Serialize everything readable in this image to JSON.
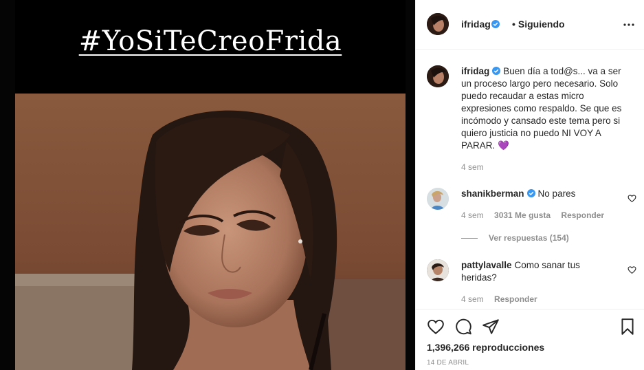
{
  "media": {
    "hashtag": "#YoSiTeCreoFrida"
  },
  "post": {
    "author": "ifridag",
    "follow_status": "Siguiendo",
    "caption": "Buen día a tod@s... va a ser un proceso largo pero necesario. Solo puedo recaudar a estas micro expresiones como respaldo. Se que es incómodo y cansado este tema pero si quiero justicia no puedo NI VOY A PARAR. 💜",
    "caption_time": "4 sem",
    "views": "1,396,266 reproducciones",
    "date": "14 DE ABRIL"
  },
  "comments": [
    {
      "username": "shanikberman",
      "text": "No pares",
      "time": "4 sem",
      "likes": "3031 Me gusta",
      "reply": "Responder",
      "view_replies": "Ver respuestas (154)"
    },
    {
      "username": "pattylavalle",
      "text": "Como sanar tus heridas?",
      "time": "4 sem",
      "reply": "Responder"
    }
  ],
  "icons": {
    "verified": "verified-badge-icon",
    "more": "more-options-icon",
    "like": "heart-icon",
    "comment": "comment-icon",
    "share": "share-icon",
    "save": "bookmark-icon"
  },
  "colors": {
    "verified": "#3897f0",
    "muted": "#8e8e8e",
    "text": "#262626"
  }
}
